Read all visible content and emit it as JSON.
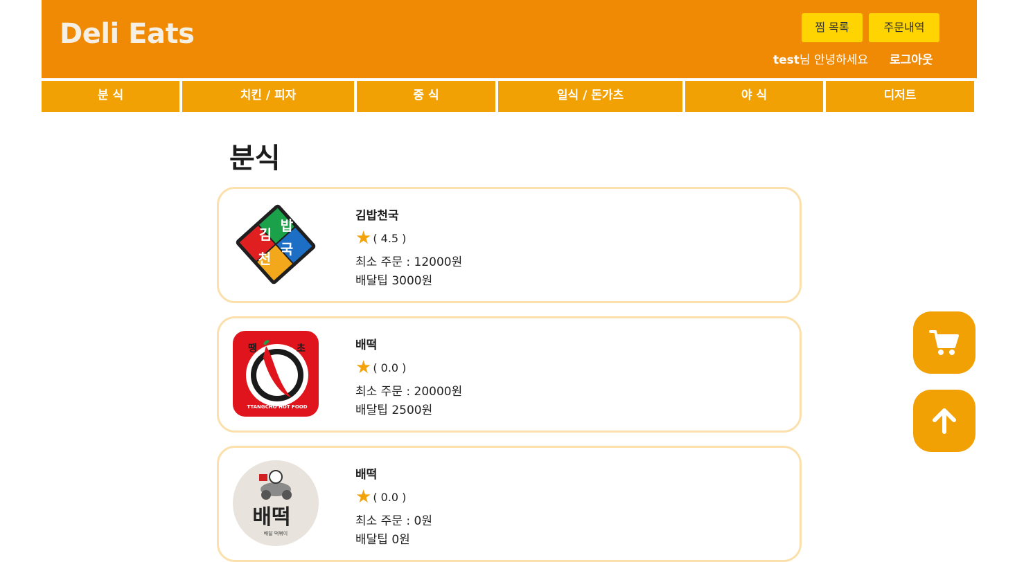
{
  "header": {
    "logo": "Deli Eats",
    "wishlist_label": "찜 목록",
    "orders_label": "주문내역",
    "user_name": "test",
    "greeting_suffix": "님 안녕하세요",
    "logout_label": "로그아웃"
  },
  "nav": {
    "items": [
      {
        "label": "분 식"
      },
      {
        "label": "치킨 / 피자"
      },
      {
        "label": "중 식"
      },
      {
        "label": "일식 / 돈가츠"
      },
      {
        "label": "야 식"
      },
      {
        "label": "디저트"
      }
    ]
  },
  "main": {
    "section_title": "분식",
    "stores": [
      {
        "name": "김밥천국",
        "rating": "( 4.5 )",
        "min_order": "최소 주문 : 12000원",
        "delivery_tip": "배달팁 3000원",
        "logo": "gimbap-cheonguk-logo",
        "logo_text": "김 밥 천 국"
      },
      {
        "name": "배떡",
        "rating": "( 0.0 )",
        "min_order": "최소 주문 : 20000원",
        "delivery_tip": "배달팁 2500원",
        "logo": "ttangcho-logo",
        "logo_text": "TTANGCHO HOT FOOD"
      },
      {
        "name": "배떡",
        "rating": "( 0.0 )",
        "min_order": "최소 주문 : 0원",
        "delivery_tip": "배달팁 0원",
        "logo": "baetteok-logo",
        "logo_text": "배떡"
      }
    ]
  },
  "floating": {
    "cart_icon": "cart-icon",
    "scroll_top_icon": "arrow-up-icon"
  },
  "colors": {
    "header_bg": "#f08a05",
    "nav_bg": "#f1a104",
    "button_yellow": "#ffd400",
    "card_border": "#fbe0ac",
    "star": "#f3a20a"
  }
}
